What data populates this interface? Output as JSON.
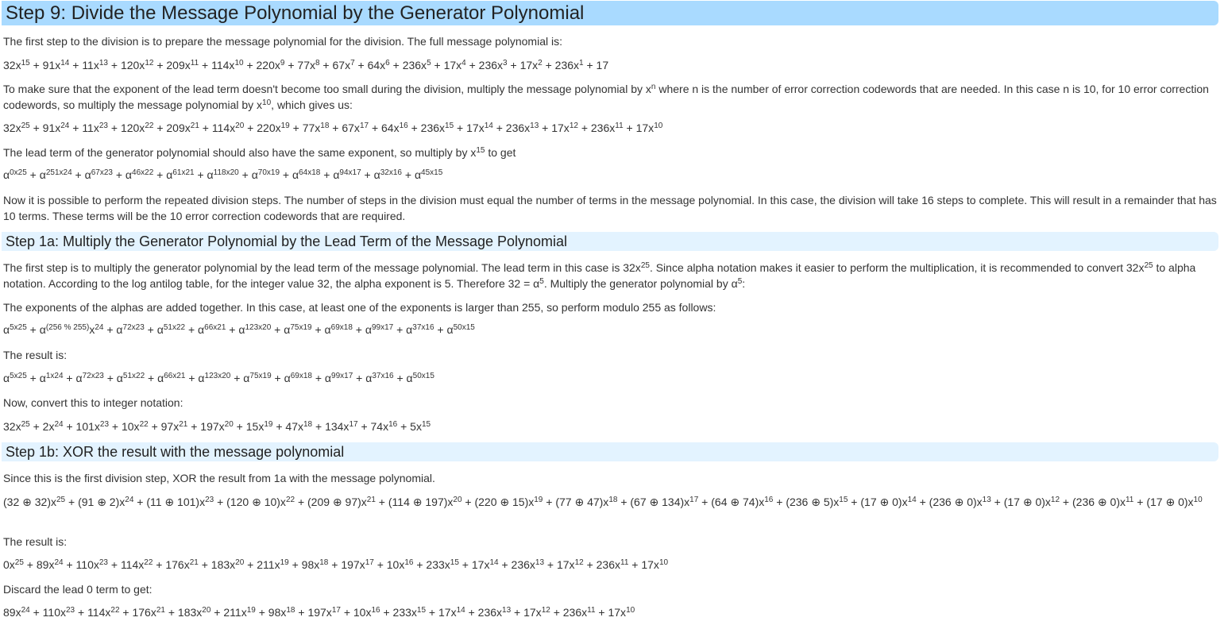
{
  "step9": {
    "title": "Step 9: Divide the Message Polynomial by the Generator Polynomial",
    "p1": "The first step to the division is to prepare the message polynomial for the division. The full message polynomial is:",
    "msg_poly": "32x^15 + 91x^14 + 11x^13 + 120x^12 + 209x^11 + 114x^10 + 220x^9 + 77x^8 + 67x^7 + 64x^6 + 236x^5 + 17x^4 + 236x^3 + 17x^2 + 236x^1 + 17",
    "p2": "To make sure that the exponent of the lead term doesn't become too small during the division, multiply the message polynomial by x^n where n is the number of error correction codewords that are needed. In this case n is 10, for 10 error correction codewords, so multiply the message polynomial by x^10, which gives us:",
    "msg_poly_shifted": "32x^25 + 91x^24 + 11x^23 + 120x^22 + 209x^21 + 114x^20 + 220x^19 + 77x^18 + 67x^17 + 64x^16 + 236x^15 + 17x^14 + 236x^13 + 17x^12 + 236x^11 + 17x^10",
    "p3": "The lead term of the generator polynomial should also have the same exponent, so multiply by x^15 to get",
    "gen_poly_shifted": "α^0x^25 + α^251x^24 + α^67x^23 + α^46x^22 + α^61x^21 + α^118x^20 + α^70x^19 + α^64x^18 + α^94x^17 + α^32x^16 + α^45x^15",
    "p4": "Now it is possible to perform the repeated division steps. The number of steps in the division must equal the number of terms in the message polynomial. In this case, the division will take 16 steps to complete. This will result in a remainder that has 10 terms. These terms will be the 10 error correction codewords that are required."
  },
  "step1a": {
    "title": "Step 1a: Multiply the Generator Polynomial by the Lead Term of the Message Polynomial",
    "p1": "The first step is to multiply the generator polynomial by the lead term of the message polynomial. The lead term in this case is 32x^25. Since alpha notation makes it easier to perform the multiplication, it is recommended to convert 32x^25 to alpha notation. According to the log antilog table, for the integer value 32, the alpha exponent is 5. Therefore 32 = α^5. Multiply the generator polynomial by α^5:",
    "p2": "The exponents of the alphas are added together. In this case, at least one of the exponents is larger than 255, so perform modulo 255 as follows:",
    "modulo_poly": "α^5x^25 + α^(256 % 255)x^24 + α^72x^23 + α^51x^22 + α^66x^21 + α^123x^20 + α^75x^19 + α^69x^18 + α^99x^17 + α^37x^16 + α^50x^15",
    "result_label": "The result is:",
    "result_alpha": "α^5x^25 + α^1x^24 + α^72x^23 + α^51x^22 + α^66x^21 + α^123x^20 + α^75x^19 + α^69x^18 + α^99x^17 + α^37x^16 + α^50x^15",
    "convert_label": "Now, convert this to integer notation:",
    "result_int": "32x^25 + 2x^24 + 101x^23 + 10x^22 + 97x^21 + 197x^20 + 15x^19 + 47x^18 + 134x^17 + 74x^16 + 5x^15"
  },
  "step1b": {
    "title": "Step 1b: XOR the result with the message polynomial",
    "p1": "Since this is the first division step, XOR the result from 1a with the message polynomial.",
    "xor_poly": "(32 ⊕ 32)x^25 + (91 ⊕ 2)x^24 + (11 ⊕ 101)x^23 + (120 ⊕ 10)x^22 + (209 ⊕ 97)x^21 + (114 ⊕ 197)x^20 + (220 ⊕ 15)x^19 + (77 ⊕ 47)x^18 + (67 ⊕ 134)x^17 + (64 ⊕ 74)x^16 + (236 ⊕ 5)x^15 + (17 ⊕ 0)x^14 + (236 ⊕ 0)x^13 + (17 ⊕ 0)x^12 + (236 ⊕ 0)x^11 + (17 ⊕ 0)x^10",
    "result_label": "The result is:",
    "result": "0x^25 + 89x^24 + 110x^23 + 114x^22 + 176x^21 + 183x^20 + 211x^19 + 98x^18 + 197x^17 + 10x^16 + 233x^15 + 17x^14 + 236x^13 + 17x^12 + 236x^11 + 17x^10",
    "discard_label": "Discard the lead 0 term to get:",
    "discarded": "89x^24 + 110x^23 + 114x^22 + 176x^21 + 183x^20 + 211x^19 + 98x^18 + 197x^17 + 10x^16 + 233x^15 + 17x^14 + 236x^13 + 17x^12 + 236x^11 + 17x^10"
  }
}
